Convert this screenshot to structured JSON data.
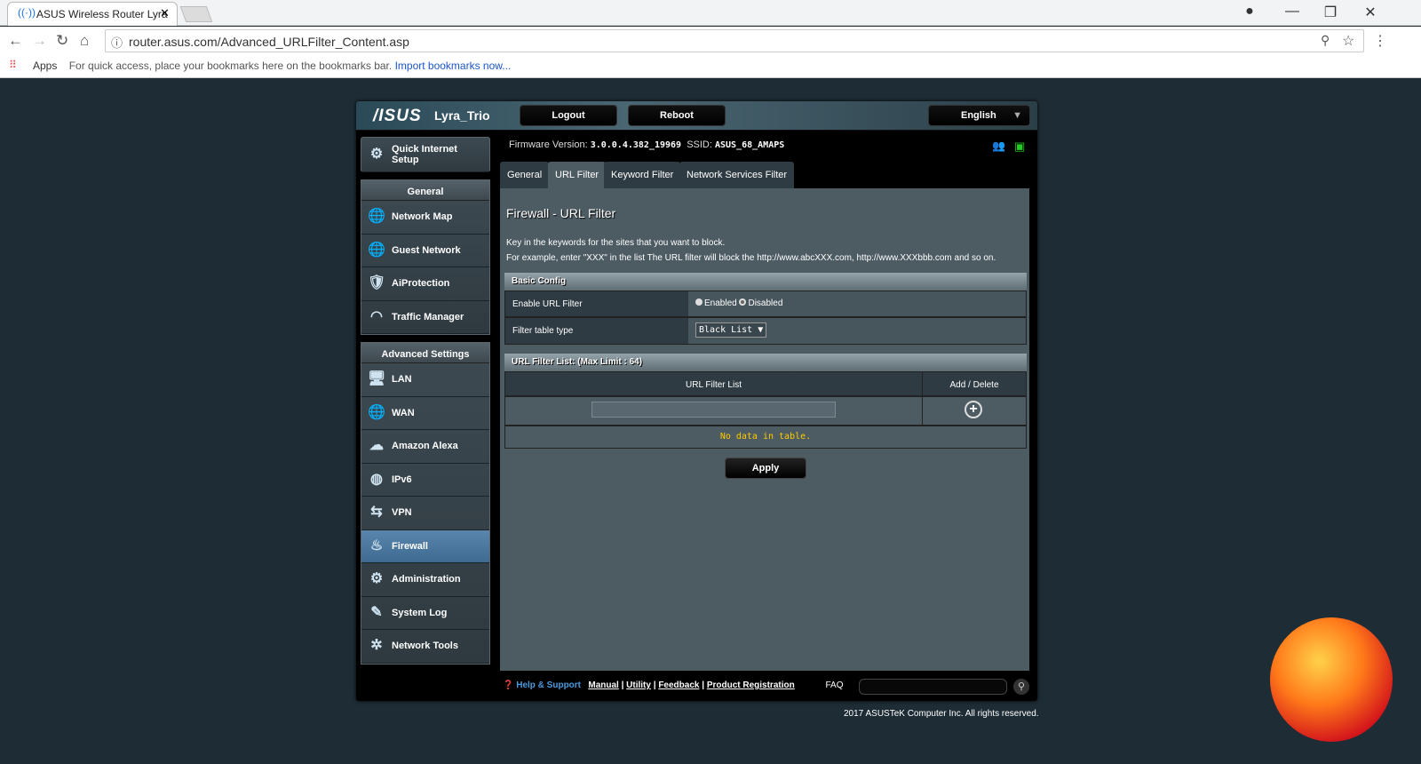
{
  "browser": {
    "tab_title": "ASUS Wireless Router Lyra",
    "url": "router.asus.com/Advanced_URLFilter_Content.asp",
    "bookmarks_apps": "Apps",
    "bookmarks_hint": "For quick access, place your bookmarks here on the bookmarks bar.",
    "bookmarks_import": "Import bookmarks now..."
  },
  "header": {
    "logo": "/ISUS",
    "model": "Lyra_Trio",
    "logout": "Logout",
    "reboot": "Reboot",
    "language": "English"
  },
  "status": {
    "fw_label": "Firmware Version:",
    "fw_value": "3.0.0.4.382_19969",
    "ssid_label": "SSID:",
    "ssid_value": "ASUS_68_AMAPS"
  },
  "sidebar": {
    "quick": "Quick Internet Setup",
    "general_header": "General",
    "general": [
      {
        "label": "Network Map",
        "icon": "globe-icon"
      },
      {
        "label": "Guest Network",
        "icon": "globe-icon"
      },
      {
        "label": "AiProtection",
        "icon": "shield-icon"
      },
      {
        "label": "Traffic Manager",
        "icon": "gauge-icon"
      }
    ],
    "advanced_header": "Advanced Settings",
    "advanced": [
      {
        "label": "LAN",
        "icon": "monitor-icon"
      },
      {
        "label": "WAN",
        "icon": "globe-icon"
      },
      {
        "label": "Amazon Alexa",
        "icon": "alexa-icon"
      },
      {
        "label": "IPv6",
        "icon": "ipv6-icon"
      },
      {
        "label": "VPN",
        "icon": "vpn-icon"
      },
      {
        "label": "Firewall",
        "icon": "fire-icon"
      },
      {
        "label": "Administration",
        "icon": "gear-icon"
      },
      {
        "label": "System Log",
        "icon": "log-icon"
      },
      {
        "label": "Network Tools",
        "icon": "tools-icon"
      }
    ],
    "active": "Firewall"
  },
  "tabs": [
    "General",
    "URL Filter",
    "Keyword Filter",
    "Network Services Filter"
  ],
  "main": {
    "title": "Firewall - URL Filter",
    "desc1": "Key in the keywords for the sites that you want to block.",
    "desc2": "For example, enter \"XXX\" in the list The URL filter will block the http://www.abcXXX.com, http://www.XXXbbb.com and so on.",
    "basic_config": "Basic Config",
    "enable_label": "Enable URL Filter",
    "enabled": "Enabled",
    "disabled": "Disabled",
    "selected": "Disabled",
    "filter_type_label": "Filter table type",
    "filter_type_value": "Black List ▼",
    "list_header": "URL Filter List: (Max Limit : 64)",
    "col_list": "URL Filter List",
    "col_add": "Add / Delete",
    "no_data": "No data in table.",
    "apply": "Apply"
  },
  "footer": {
    "help": "Help & Support",
    "manual": "Manual",
    "utility": "Utility",
    "feedback": "Feedback",
    "registration": "Product Registration",
    "faq": "FAQ",
    "copyright": "2017 ASUSTeK Computer Inc. All rights reserved."
  }
}
